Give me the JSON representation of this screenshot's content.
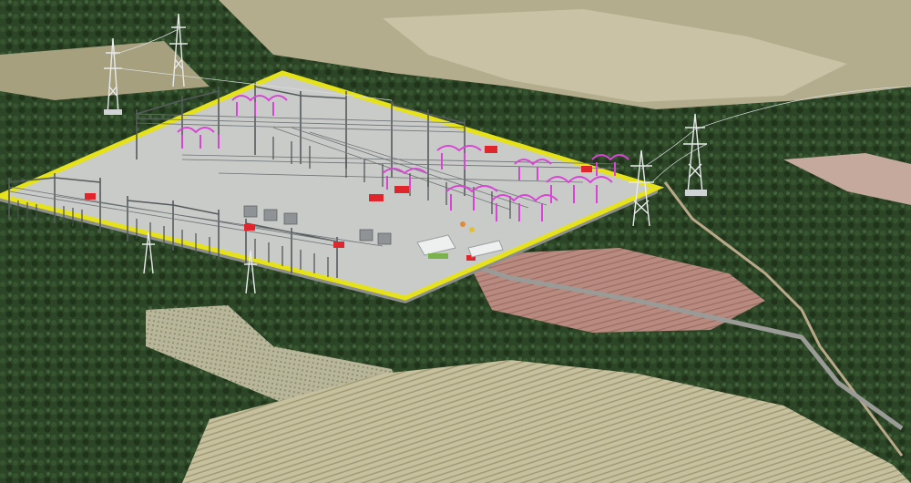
{
  "scene": {
    "kind": "aerial-3d-render",
    "subject": "substation-model",
    "palette": {
      "forest_dark": "#24391f",
      "forest_mid": "#3b5a32",
      "field_light": "#b9b38f",
      "field_pale": "#d8d2b4",
      "field_red": "#a8756a",
      "pad_gray": "#c9cbc9",
      "fence_yellow": "#e6e21a",
      "steel": "#555a5c",
      "busbar_magenta": "#d845d4",
      "equipment_red": "#e0262d",
      "road_gray": "#9a9a96",
      "building_white": "#eef0f0"
    },
    "icons": [
      "transmission-tower-icon",
      "transformer-icon",
      "busbar-icon",
      "control-building-icon"
    ]
  }
}
